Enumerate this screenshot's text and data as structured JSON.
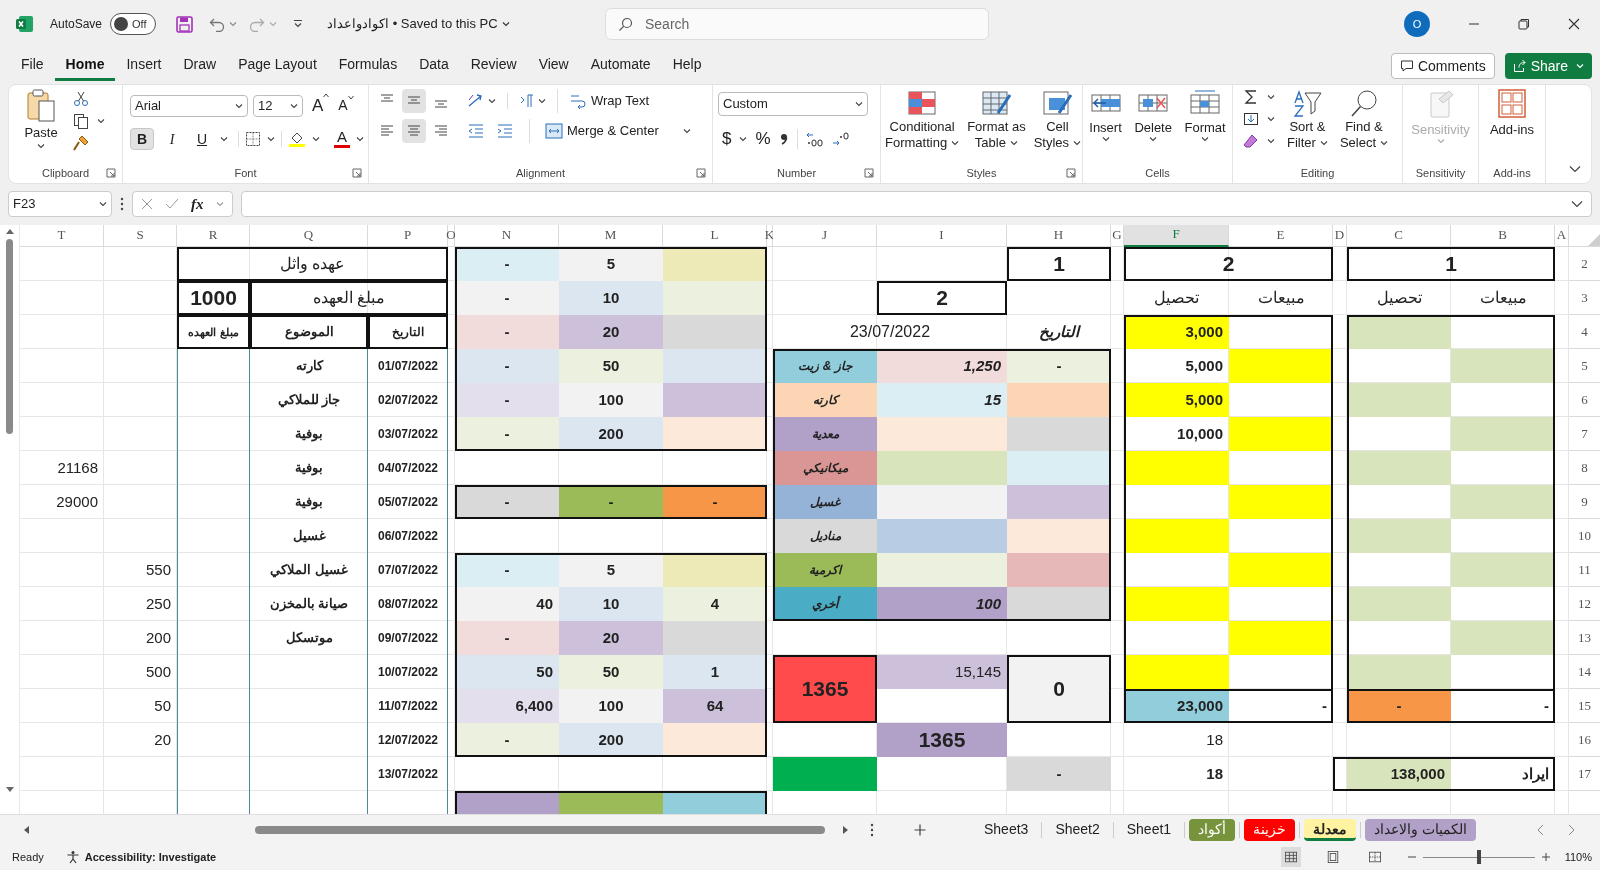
{
  "title_bar": {
    "autosave_label": "AutoSave",
    "autosave": {
      "on": false,
      "label": "Off"
    },
    "document_title": "اكوادواعداد • Saved to this PC",
    "search_placeholder": "Search",
    "avatar": "O"
  },
  "menu_tabs": [
    {
      "label": "File",
      "selected": false
    },
    {
      "label": "Home",
      "selected": true
    },
    {
      "label": "Insert",
      "selected": false
    },
    {
      "label": "Draw",
      "selected": false
    },
    {
      "label": "Page Layout",
      "selected": false
    },
    {
      "label": "Formulas",
      "selected": false
    },
    {
      "label": "Data",
      "selected": false
    },
    {
      "label": "Review",
      "selected": false
    },
    {
      "label": "View",
      "selected": false
    },
    {
      "label": "Automate",
      "selected": false
    },
    {
      "label": "Help",
      "selected": false
    }
  ],
  "header_buttons": {
    "comments": "Comments",
    "share": "Share"
  },
  "ribbon": {
    "clipboard": {
      "paste": "Paste",
      "label": "Clipboard"
    },
    "font": {
      "family": "Arial",
      "size": "12",
      "grow": "A",
      "shrink": "A",
      "format_buttons": [
        {
          "label": "B",
          "pressed": true
        },
        {
          "label": "I",
          "pressed": false
        },
        {
          "label": "U",
          "pressed": false
        }
      ],
      "font_color": "A",
      "label": "Font"
    },
    "alignment": {
      "vertical": [
        {
          "selected": false
        },
        {
          "selected": true
        },
        {
          "selected": false
        }
      ],
      "horizontal": [
        {
          "selected": false
        },
        {
          "selected": true
        },
        {
          "selected": false
        }
      ],
      "wrap": "Wrap Text",
      "merge": "Merge & Center",
      "label": "Alignment"
    },
    "number": {
      "format": "Custom",
      "currency": "$",
      "percent": "%",
      "label": "Number"
    },
    "styles": {
      "buttons": [
        [
          "Conditional",
          "Formatting"
        ],
        [
          "Format as",
          "Table"
        ],
        [
          "Cell",
          "Styles"
        ]
      ],
      "label": "Styles"
    },
    "cells": {
      "buttons": [
        "Insert",
        "Delete",
        "Format"
      ],
      "label": "Cells"
    },
    "editing": {
      "buttons": [
        [
          "Sort &",
          "Filter"
        ],
        [
          "Find &",
          "Select"
        ]
      ],
      "label": "Editing"
    },
    "sensitivity": {
      "button": "Sensitivity",
      "disabled": true,
      "label": "Sensitivity"
    },
    "addins": {
      "button": "Add-ins",
      "label": "Add-ins"
    }
  },
  "formula_bar": {
    "name_box": "F23",
    "fx": "fx"
  },
  "sheet": {
    "columns": [
      {
        "label": "T",
        "selected": false
      },
      {
        "label": "S",
        "selected": false
      },
      {
        "label": "R",
        "selected": false
      },
      {
        "label": "Q",
        "selected": false
      },
      {
        "label": "P",
        "selected": false
      },
      {
        "label": "O",
        "selected": false
      },
      {
        "label": "N",
        "selected": false
      },
      {
        "label": "M",
        "selected": false
      },
      {
        "label": "L",
        "selected": false
      },
      {
        "label": "K",
        "selected": false
      },
      {
        "label": "J",
        "selected": false
      },
      {
        "label": "I",
        "selected": false
      },
      {
        "label": "H",
        "selected": false
      },
      {
        "label": "G",
        "selected": false
      },
      {
        "label": "F",
        "selected": true
      },
      {
        "label": "E",
        "selected": false
      },
      {
        "label": "D",
        "selected": false
      },
      {
        "label": "C",
        "selected": false
      },
      {
        "label": "B",
        "selected": false
      },
      {
        "label": "A",
        "selected": false
      }
    ],
    "rows": [
      {
        "header": "2",
        "cells": [
          {},
          {},
          {},
          {
            "text": "عهده واثل"
          },
          {},
          {},
          {
            "text": "-",
            "color": "#daeef3"
          },
          {
            "text": "5",
            "color": "#f2f2f2"
          },
          {
            "color": "#eeeab8"
          },
          {},
          {},
          {},
          {
            "text": "1"
          },
          {},
          {
            "text": "2"
          },
          {},
          {},
          {
            "text": "1"
          }
        ]
      },
      {
        "header": "3",
        "cells": [
          {},
          {},
          {
            "text": "1000"
          },
          {
            "text": "مبلغ العهده"
          },
          {},
          {},
          {
            "text": "-",
            "color": "#f2f2f2"
          },
          {
            "text": "10",
            "color": "#dce6f1"
          },
          {
            "color": "#ebf1de"
          },
          {},
          {},
          {
            "text": "2"
          },
          {},
          {},
          {
            "text": "تحصيل"
          },
          {
            "text": "مبيعات"
          },
          {},
          {
            "text": "تحصيل"
          },
          {
            "text": "مبيعات"
          }
        ]
      },
      {
        "header": "4",
        "cells": [
          {},
          {},
          {
            "text": "مبلغ العهده"
          },
          {
            "text": "الموضوع"
          },
          {
            "text": "التاريخ"
          },
          {},
          {
            "text": "-",
            "color": "#f2dcdb"
          },
          {
            "text": "20",
            "color": "#ccc0da"
          },
          {
            "color": "#d9d9d9"
          },
          {},
          {},
          {
            "text": "23/07/2022"
          },
          {
            "text": "التاريخ"
          },
          {},
          {
            "text": "3,000",
            "color": "#ffff00"
          },
          {},
          {},
          {
            "color": "#d8e4bc"
          }
        ]
      },
      {
        "header": "5",
        "cells": [
          {},
          {},
          {},
          {
            "text": "كارته"
          },
          {
            "text": "01/07/2022"
          },
          {},
          {
            "text": "-",
            "color": "#dce6f1"
          },
          {
            "text": "50",
            "color": "#ebf1de"
          },
          {
            "color": "#dce6f1"
          },
          {},
          {
            "text": "جاز & زيت",
            "color": "#92cddc"
          },
          {
            "text": "1,250",
            "color": "#f2dcdb"
          },
          {
            "text": "-",
            "color": "#ebf1de"
          },
          {},
          {
            "text": "5,000"
          },
          {
            "color": "#ffff00"
          },
          {},
          {},
          {
            "color": "#d8e4bc"
          }
        ]
      },
      {
        "header": "6",
        "cells": [
          {},
          {},
          {},
          {
            "text": "جاز للملاكي"
          },
          {
            "text": "02/07/2022"
          },
          {},
          {
            "text": "-",
            "color": "#e4dfec"
          },
          {
            "text": "100",
            "color": "#f2f2f2"
          },
          {
            "color": "#ccc0da"
          },
          {},
          {
            "text": "كارته",
            "color": "#fcd5b4"
          },
          {
            "text": "15",
            "color": "#daeef3"
          },
          {
            "color": "#fcd5b4"
          },
          {},
          {
            "text": "5,000",
            "color": "#ffff00"
          },
          {},
          {},
          {
            "color": "#d8e4bc"
          }
        ]
      },
      {
        "header": "7",
        "cells": [
          {},
          {},
          {},
          {
            "text": "بوفية"
          },
          {
            "text": "03/07/2022"
          },
          {},
          {
            "text": "-",
            "color": "#ebf1de"
          },
          {
            "text": "200",
            "color": "#dce6f1"
          },
          {
            "color": "#fde9d9"
          },
          {},
          {
            "text": "معدية",
            "color": "#b1a0c7"
          },
          {
            "color": "#fde9d9"
          },
          {
            "color": "#d9d9d9"
          },
          {},
          {
            "text": "10,000"
          },
          {
            "color": "#ffff00"
          },
          {},
          {},
          {
            "color": "#d8e4bc"
          }
        ]
      },
      {
        "header": "8",
        "cells": [
          {
            "text": "21168"
          },
          {},
          {},
          {
            "text": "بوفية"
          },
          {
            "text": "04/07/2022"
          },
          {},
          {},
          {},
          {},
          {},
          {
            "text": "ميكانيكي",
            "color": "#da9694"
          },
          {
            "color": "#d8e4bc"
          },
          {
            "color": "#daeef3"
          },
          {},
          {
            "color": "#ffff00"
          },
          {},
          {},
          {
            "color": "#d8e4bc"
          }
        ]
      },
      {
        "header": "9",
        "cells": [
          {
            "text": "29000"
          },
          {},
          {},
          {
            "text": "بوفية"
          },
          {
            "text": "05/07/2022"
          },
          {},
          {
            "text": "-",
            "color": "#d9d9d9"
          },
          {
            "text": "-",
            "color": "#9bbb59"
          },
          {
            "text": "-",
            "color": "#f79646"
          },
          {},
          {
            "text": "غسيل",
            "color": "#95b3d7"
          },
          {
            "color": "#f2f2f2"
          },
          {
            "color": "#ccc0da"
          },
          {},
          {},
          {
            "color": "#ffff00"
          },
          {},
          {},
          {
            "color": "#d8e4bc"
          }
        ]
      },
      {
        "header": "10",
        "cells": [
          {},
          {},
          {},
          {
            "text": "غسيل"
          },
          {
            "text": "06/07/2022"
          },
          {},
          {},
          {},
          {},
          {},
          {
            "text": "مناديل",
            "color": "#d9d9d9"
          },
          {
            "color": "#b8cce4"
          },
          {
            "color": "#fde9d9"
          },
          {},
          {
            "color": "#ffff00"
          },
          {},
          {},
          {
            "color": "#d8e4bc"
          }
        ]
      },
      {
        "header": "11",
        "cells": [
          {},
          {
            "text": "550"
          },
          {},
          {
            "text": "غسيل الملاكي"
          },
          {
            "text": "07/07/2022"
          },
          {},
          {
            "text": "-",
            "color": "#daeef3"
          },
          {
            "text": "5",
            "color": "#f2f2f2"
          },
          {
            "color": "#eeeab8"
          },
          {},
          {
            "text": "اكرمية",
            "color": "#9bbb59"
          },
          {
            "color": "#ebf1de"
          },
          {
            "color": "#e6b8b7"
          },
          {},
          {},
          {
            "color": "#ffff00"
          },
          {},
          {},
          {
            "color": "#d8e4bc"
          }
        ]
      },
      {
        "header": "12",
        "cells": [
          {},
          {
            "text": "250"
          },
          {},
          {
            "text": "صيانة بالمخزن"
          },
          {
            "text": "08/07/2022"
          },
          {},
          {
            "text": "40",
            "color": "#f2f2f2"
          },
          {
            "text": "10",
            "color": "#dce6f1"
          },
          {
            "text": "4",
            "color": "#ebf1de"
          },
          {},
          {
            "text": "أخري",
            "color": "#4bacc6"
          },
          {
            "text": "100",
            "color": "#b1a0c7"
          },
          {
            "color": "#d9d9d9"
          },
          {},
          {
            "color": "#ffff00"
          },
          {},
          {},
          {
            "color": "#d8e4bc"
          }
        ]
      },
      {
        "header": "13",
        "cells": [
          {},
          {
            "text": "200"
          },
          {},
          {
            "text": "موتسكل"
          },
          {
            "text": "09/07/2022"
          },
          {},
          {
            "text": "-",
            "color": "#f2dcdb"
          },
          {
            "text": "20",
            "color": "#ccc0da"
          },
          {
            "color": "#d9d9d9"
          },
          {},
          {},
          {},
          {},
          {},
          {},
          {
            "color": "#ffff00"
          },
          {},
          {},
          {
            "color": "#d8e4bc"
          }
        ]
      },
      {
        "header": "14",
        "cells": [
          {},
          {
            "text": "500"
          },
          {},
          {},
          {
            "text": "10/07/2022"
          },
          {},
          {
            "text": "50",
            "color": "#dce6f1"
          },
          {
            "text": "50",
            "color": "#ebf1de"
          },
          {
            "text": "1",
            "color": "#dce6f1"
          },
          {},
          {
            "text": "1365",
            "color": "#ff4b4b"
          },
          {
            "text": "15,145",
            "color": "#ccc0da"
          },
          {
            "text": "0",
            "color": "#f2f2f2"
          },
          {},
          {
            "color": "#ffff00"
          },
          {},
          {},
          {
            "color": "#d8e4bc"
          }
        ]
      },
      {
        "header": "15",
        "cells": [
          {},
          {
            "text": "50"
          },
          {},
          {},
          {
            "text": "11/07/2022"
          },
          {},
          {
            "text": "6,400",
            "color": "#e4dfec"
          },
          {
            "text": "100",
            "color": "#f2f2f2"
          },
          {
            "text": "64",
            "color": "#ccc0da"
          },
          {},
          {},
          {},
          {},
          {},
          {
            "text": "23,000",
            "color": "#92cddc"
          },
          {
            "text": "-"
          },
          {},
          {
            "text": "-",
            "color": "#f79646"
          },
          {
            "text": "-"
          }
        ]
      },
      {
        "header": "16",
        "cells": [
          {},
          {
            "text": "20"
          },
          {},
          {},
          {
            "text": "12/07/2022"
          },
          {},
          {
            "text": "-",
            "color": "#ebf1de"
          },
          {
            "text": "200",
            "color": "#dce6f1"
          },
          {
            "color": "#fde9d9"
          },
          {},
          {},
          {
            "text": "1365",
            "color": "#b1a0c7"
          },
          {},
          {},
          {
            "text": "18"
          }
        ]
      },
      {
        "header": "17",
        "cells": [
          {},
          {},
          {},
          {},
          {
            "text": "13/07/2022"
          },
          {},
          {},
          {},
          {},
          {},
          {
            "color": "#00b050"
          },
          {},
          {
            "text": "-",
            "color": "#d9d9d9"
          },
          {},
          {
            "text": "18"
          },
          {},
          {},
          {
            "text": "138,000",
            "color": "#d8e4bc"
          },
          {
            "text": "ايراد"
          }
        ]
      },
      {
        "cells": [
          {},
          {},
          {},
          {},
          {},
          {},
          {
            "color": "#b1a0c7"
          },
          {
            "color": "#9bbb59"
          },
          {
            "color": "#92cddc"
          }
        ]
      }
    ]
  },
  "sheet_tabs": [
    {
      "label": "الكميات والاعداد",
      "selected": false,
      "color": "#b1a0c7"
    },
    {
      "label": "معدلة",
      "selected": true,
      "color": "#fff2a0"
    },
    {
      "label": "خزينة",
      "selected": false,
      "color": "#ff0000"
    },
    {
      "label": "أكواد",
      "selected": false,
      "color": "#77933c"
    },
    {
      "label": "Sheet1",
      "selected": false
    },
    {
      "label": "Sheet2",
      "selected": false
    },
    {
      "label": "Sheet3",
      "selected": false
    }
  ],
  "status_bar": {
    "ready": "Ready",
    "accessibility": "Accessibility: Investigate",
    "view_modes": [
      {
        "selected": true
      },
      {
        "selected": false
      },
      {
        "selected": false
      }
    ],
    "zoom_slider": {
      "level": 0.5
    },
    "zoom": "110%"
  }
}
